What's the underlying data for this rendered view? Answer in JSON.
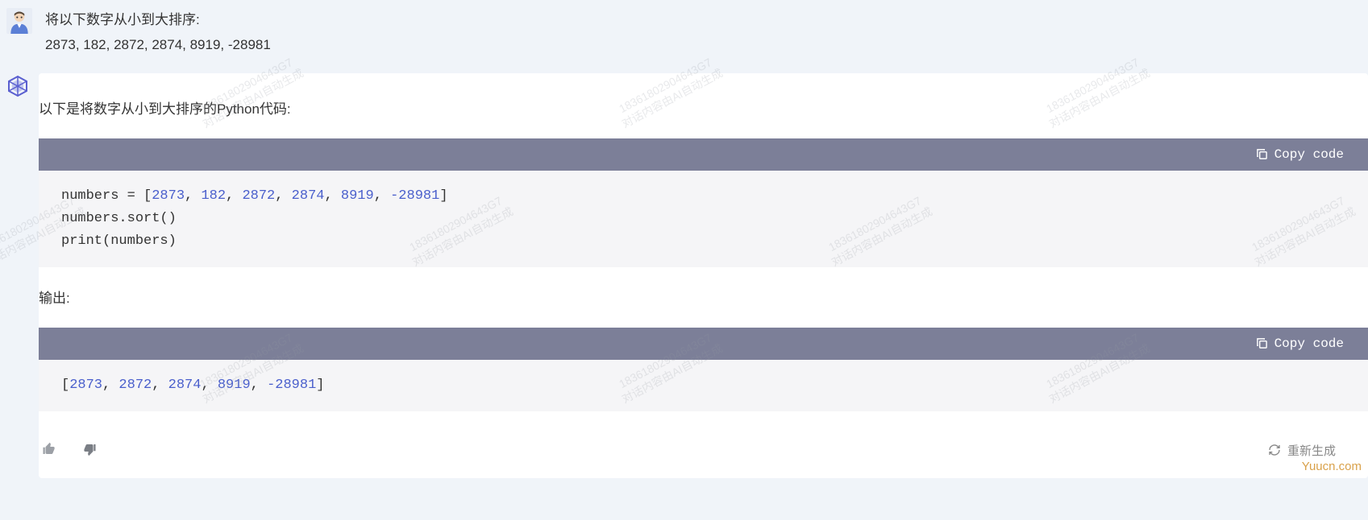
{
  "user_message": {
    "line1": "将以下数字从小到大排序:",
    "line2": "2873, 182, 2872, 2874, 8919, -28981"
  },
  "ai_message": {
    "intro": "以下是将数字从小到大排序的Python代码:",
    "code_block_1": {
      "copy_label": "Copy code",
      "code_plain": "numbers = [2873, 182, 2872, 2874, 8919, -28981]\nnumbers.sort()\nprint(numbers)"
    },
    "output_label": "输出:",
    "code_block_2": {
      "copy_label": "Copy code",
      "code_plain": "[2873, 2872, 2874, 8919, -28981]"
    }
  },
  "actions": {
    "regenerate_label": "重新生成"
  },
  "watermark": {
    "id_line": "18361802904643G7",
    "text_line": "对话内容由AI自动生成"
  },
  "source_label": "Yuucn.com"
}
